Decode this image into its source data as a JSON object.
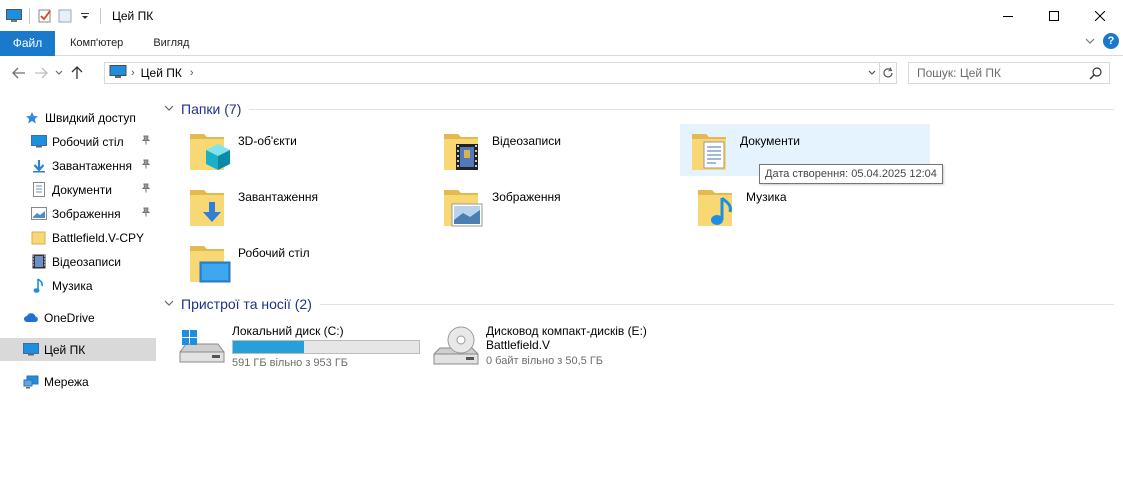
{
  "window": {
    "title": "Цей ПК",
    "controls": {
      "minimize": "—",
      "maximize": "☐",
      "close": "✕"
    }
  },
  "ribbon": {
    "tabs": [
      "Файл",
      "Комп'ютер",
      "Вигляд"
    ]
  },
  "address": {
    "breadcrumb": [
      "Цей ПК"
    ],
    "search_placeholder": "Пошук: Цей ПК"
  },
  "sidebar": {
    "quick_access": "Швидкий доступ",
    "pinned": [
      {
        "label": "Робочий стіл",
        "icon": "desktop-icon",
        "pinned": true
      },
      {
        "label": "Завантаження",
        "icon": "download-icon",
        "pinned": true
      },
      {
        "label": "Документи",
        "icon": "document-icon",
        "pinned": true
      },
      {
        "label": "Зображення",
        "icon": "picture-icon",
        "pinned": true
      },
      {
        "label": "Battlefield.V-CPY",
        "icon": "folder-icon",
        "pinned": false
      },
      {
        "label": "Відеозаписи",
        "icon": "video-icon",
        "pinned": false
      },
      {
        "label": "Музика",
        "icon": "music-icon",
        "pinned": false
      }
    ],
    "onedrive": "OneDrive",
    "this_pc": "Цей ПК",
    "network": "Мережа"
  },
  "folders_group": {
    "title": "Папки (7)",
    "items": [
      {
        "label": "3D-об'єкти",
        "overlay": "3d-icon"
      },
      {
        "label": "Відеозаписи",
        "overlay": "video-icon"
      },
      {
        "label": "Документи",
        "overlay": "document-icon"
      },
      {
        "label": "Завантаження",
        "overlay": "download-icon"
      },
      {
        "label": "Зображення",
        "overlay": "picture-icon"
      },
      {
        "label": "Музика",
        "overlay": "music-icon"
      },
      {
        "label": "Робочий стіл",
        "overlay": "desktop-icon"
      }
    ]
  },
  "devices_group": {
    "title": "Пристрої та носії (2)",
    "drives": [
      {
        "name": "Локальний диск (C:)",
        "free": "591 ГБ вільно з 953 ГБ",
        "used_fraction": 0.38
      },
      {
        "name": "Дисковод компакт-дисків (E:)",
        "sub": "Battlefield.V",
        "free": "0 байт вільно з 50,5 ГБ"
      }
    ]
  },
  "tooltip": "Дата створення: 05.04.2025 12:04",
  "colors": {
    "accent": "#1979ca",
    "folder": "#f8d775",
    "progress": "#26a0da",
    "group_title": "#1e3287"
  }
}
